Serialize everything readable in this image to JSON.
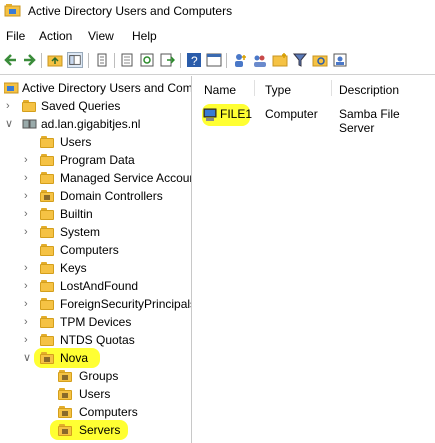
{
  "window": {
    "title": "Active Directory Users and Computers"
  },
  "menu": [
    "File",
    "Action",
    "View",
    "Help"
  ],
  "toolbar": {
    "buttons": [
      "back-icon",
      "forward-icon",
      "up-folder-icon",
      "show-pane-icon",
      "delete-icon",
      "properties-icon",
      "refresh-icon",
      "export-icon",
      "help-icon",
      "console-icon",
      "add-user-icon",
      "add-group-icon",
      "add-ou-icon",
      "filter-icon",
      "query-icon",
      "group-icon"
    ]
  },
  "tree": {
    "root": "Active Directory Users and Com",
    "saved_queries": "Saved Queries",
    "domain": "ad.lan.gigabitjes.nl",
    "containers": [
      "Users",
      "Program Data",
      "Managed Service Accour",
      "Domain Controllers",
      "Builtin",
      "System",
      "Computers",
      "Keys",
      "LostAndFound",
      "ForeignSecurityPrincipals",
      "TPM Devices",
      "NTDS Quotas"
    ],
    "nova": "Nova",
    "nova_children": [
      "Groups",
      "Users",
      "Computers",
      "Servers"
    ]
  },
  "list": {
    "columns": [
      "Name",
      "Type",
      "Description"
    ],
    "rows": [
      {
        "name": "FILE1",
        "type": "Computer",
        "description": "Samba File Server"
      }
    ]
  },
  "colors": {
    "highlight": "#ffff33",
    "folder": "#f5c244"
  }
}
